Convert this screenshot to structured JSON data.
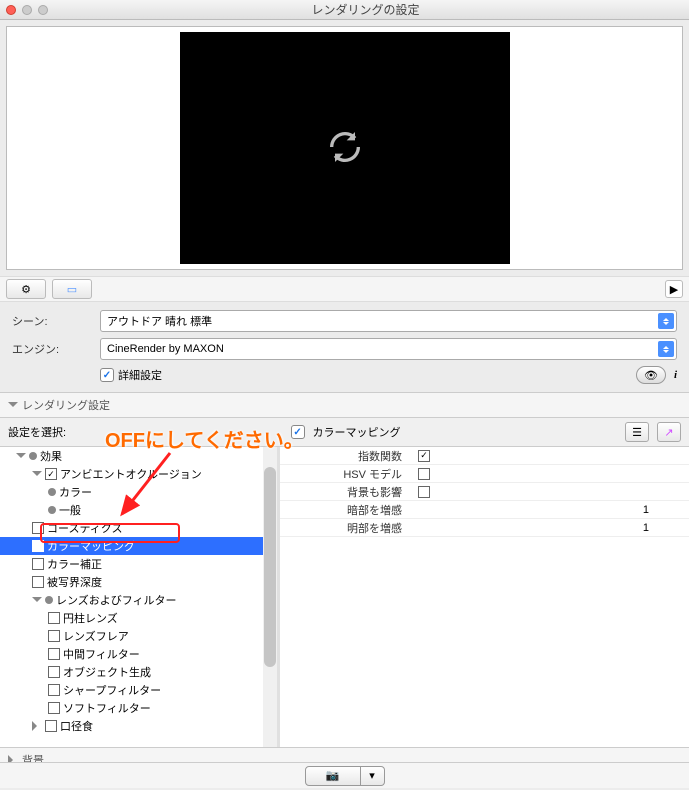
{
  "window": {
    "title": "レンダリングの設定"
  },
  "form": {
    "scene_label": "シーン:",
    "scene_value": "アウトドア 晴れ 標準",
    "engine_label": "エンジン:",
    "engine_value": "CineRender by MAXON",
    "detail_label": "詳細設定"
  },
  "section": {
    "rendering": "レンダリング設定",
    "background": "背景"
  },
  "select_row": {
    "label": "設定を選択:",
    "header_label": "カラーマッピング"
  },
  "tree": {
    "effects": "効果",
    "ambient": "アンビエントオクルージョン",
    "color": "カラー",
    "general": "一般",
    "caustics": "コースティクス",
    "colormapping": "カラーマッピング",
    "colorcorrect": "カラー補正",
    "dof": "被写界深度",
    "lensfilter": "レンズおよびフィルター",
    "cylens": "円柱レンズ",
    "lensflare": "レンズフレア",
    "midfilter": "中間フィルター",
    "objgen": "オブジェクト生成",
    "sharpfilter": "シャープフィルター",
    "softfilter": "ソフトフィルター",
    "vignette": "口径食"
  },
  "props": {
    "exponent": "指数関数",
    "hsv": "HSV モデル",
    "bg": "背景も影響",
    "dark": "暗部を増感",
    "bright": "明部を増感",
    "val1": "1",
    "val2": "1"
  },
  "annotation": {
    "text": "OFFにしてください。"
  }
}
